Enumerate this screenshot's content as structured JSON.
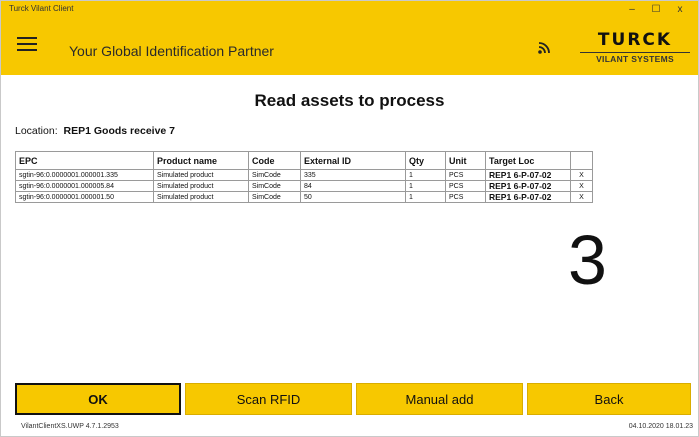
{
  "window": {
    "title": "Turck Vilant Client",
    "controls": {
      "minimize": "–",
      "maximize": "☐",
      "close": "x"
    }
  },
  "header": {
    "tagline": "Your Global Identification Partner",
    "logo_brand": "TURCK",
    "logo_sub": "VILANT SYSTEMS",
    "rfid_icon": "rfid-signal-icon",
    "menu_icon": "hamburger-menu-icon"
  },
  "main": {
    "title": "Read assets to process",
    "location_label": "Location:",
    "location_value": "REP1 Goods receive 7",
    "table": {
      "headers": [
        "EPC",
        "Product name",
        "Code",
        "External ID",
        "Qty",
        "Unit",
        "Target Loc",
        ""
      ],
      "rows": [
        [
          "sgtin-96:0.0000001.000001.335",
          "Simulated product",
          "SimCode",
          "335",
          "1",
          "PCS",
          "REP1 6-P-07-02",
          "X"
        ],
        [
          "sgtin-96:0.0000001.000005.84",
          "Simulated product",
          "SimCode",
          "84",
          "1",
          "PCS",
          "REP1 6-P-07-02",
          "X"
        ],
        [
          "sgtin-96:0.0000001.000001.50",
          "Simulated product",
          "SimCode",
          "50",
          "1",
          "PCS",
          "REP1 6-P-07-02",
          "X"
        ]
      ]
    },
    "count": "3"
  },
  "buttons": {
    "ok": "OK",
    "scan_rfid": "Scan RFID",
    "manual_add": "Manual add",
    "back": "Back"
  },
  "status": {
    "version": "VilantClientXS.UWP 4.7.1.2953",
    "datetime": "04.10.2020 18.01.23"
  },
  "colors": {
    "accent": "#f7c800",
    "text": "#111111",
    "border": "#9a9a9a"
  }
}
